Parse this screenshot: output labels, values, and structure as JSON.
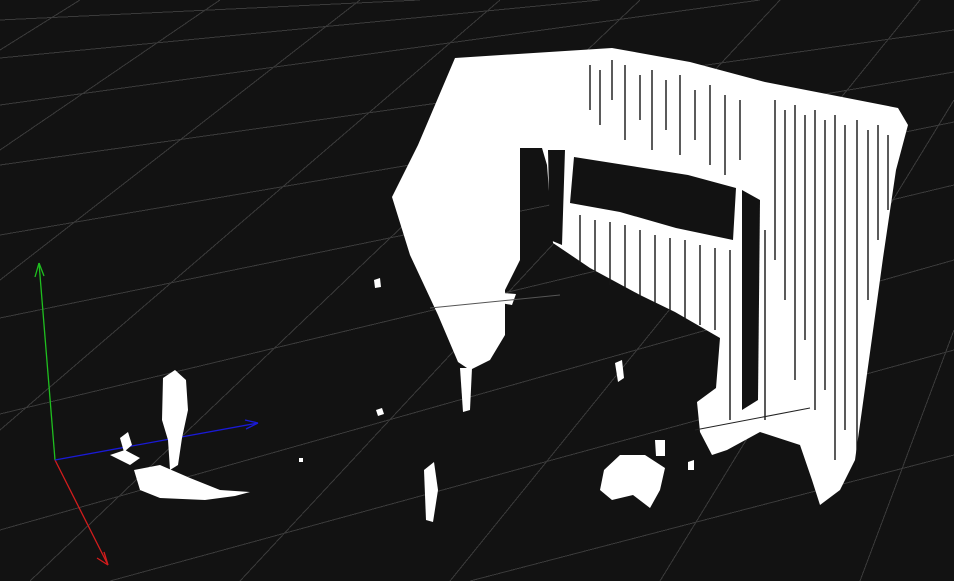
{
  "viewer": {
    "background_color": "#121212",
    "grid_color": "#3a3a3a",
    "point_color": "#ffffff"
  },
  "axes": {
    "x_axis": {
      "icon": "x-axis-arrow",
      "color": "#d31c1c"
    },
    "y_axis": {
      "icon": "y-axis-arrow",
      "color": "#1fbf1f"
    },
    "z_axis": {
      "icon": "z-axis-arrow",
      "color": "#1a1ad6"
    }
  },
  "cloud": {
    "objects": [
      {
        "name": "wall-structure",
        "kind": "point-cloud-cluster"
      },
      {
        "name": "window-opening",
        "kind": "point-cloud-hole"
      },
      {
        "name": "small-object-left",
        "kind": "point-cloud-cluster"
      },
      {
        "name": "small-object-center",
        "kind": "point-cloud-cluster"
      },
      {
        "name": "floor-clutter",
        "kind": "point-cloud-cluster"
      }
    ]
  }
}
